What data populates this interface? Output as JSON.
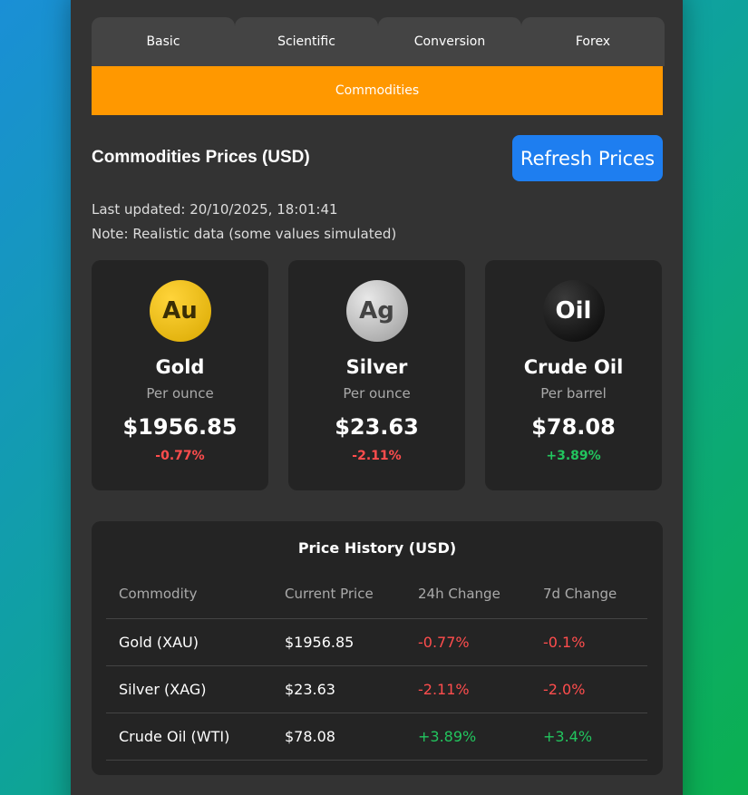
{
  "tabs": [
    {
      "label": "Basic"
    },
    {
      "label": "Scientific"
    },
    {
      "label": "Conversion"
    },
    {
      "label": "Forex"
    }
  ],
  "active_tab": {
    "label": "Commodities"
  },
  "header": {
    "title": "Commodities Prices (USD)",
    "refresh_label": "Refresh Prices"
  },
  "meta": {
    "last_updated": "Last updated: 20/10/2025, 18:01:41",
    "note": "Note: Realistic data (some values simulated)"
  },
  "cards": [
    {
      "symbol": "Au",
      "name": "Gold",
      "unit": "Per ounce",
      "price": "$1956.85",
      "change": "-0.77%",
      "trend": "down"
    },
    {
      "symbol": "Ag",
      "name": "Silver",
      "unit": "Per ounce",
      "price": "$23.63",
      "change": "-2.11%",
      "trend": "down"
    },
    {
      "symbol": "Oil",
      "name": "Crude Oil",
      "unit": "Per barrel",
      "price": "$78.08",
      "change": "+3.89%",
      "trend": "up"
    }
  ],
  "history": {
    "title": "Price History (USD)",
    "columns": [
      "Commodity",
      "Current Price",
      "24h Change",
      "7d Change"
    ],
    "rows": [
      {
        "commodity": "Gold (XAU)",
        "price": "$1956.85",
        "change_24h": "-0.77%",
        "change_7d": "-0.1%"
      },
      {
        "commodity": "Silver (XAG)",
        "price": "$23.63",
        "change_24h": "-2.11%",
        "change_7d": "-2.0%"
      },
      {
        "commodity": "Crude Oil (WTI)",
        "price": "$78.08",
        "change_24h": "+3.89%",
        "change_7d": "+3.4%"
      }
    ]
  },
  "colors": {
    "accent": "#ff9800",
    "button": "#1e7ef0",
    "negative": "#ff4d4d",
    "positive": "#22c55e"
  }
}
